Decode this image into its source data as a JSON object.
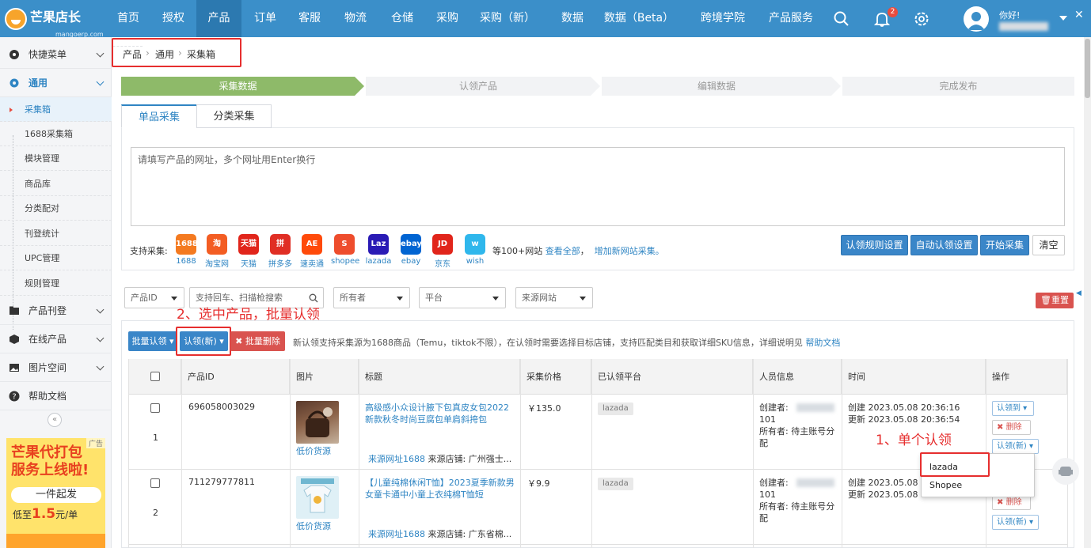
{
  "brand": {
    "name": "芒果店长",
    "domain": "mangoerp.com"
  },
  "topnav": [
    "首页",
    "授权",
    "产品",
    "订单",
    "客服",
    "物流",
    "仓储",
    "采购",
    "采购（新）",
    "数据",
    "数据（Beta）",
    "跨境学院",
    "产品服务"
  ],
  "notif_count": "2",
  "user": {
    "greeting": "你好!"
  },
  "sidebar": {
    "menus": [
      "快捷菜单",
      "通用",
      "产品刊登",
      "在线产品",
      "图片空间",
      "帮助文档"
    ],
    "subitems": [
      "采集箱",
      "1688采集箱",
      "模块管理",
      "商品库",
      "分类配对",
      "刊登统计",
      "UPC管理",
      "规则管理"
    ],
    "collapse": "«"
  },
  "ad": {
    "tag": "广告",
    "line1": "芒果代打包",
    "line2": "服务上线啦!",
    "line3": "一件起发",
    "line4_pre": "低至",
    "line4_num": "1.5",
    "line4_post": "元/单"
  },
  "breadcrumb": [
    "产品",
    "通用",
    "采集箱"
  ],
  "steps": [
    "采集数据",
    "认领产品",
    "编辑数据",
    "完成发布"
  ],
  "tabs": [
    "单品采集",
    "分类采集"
  ],
  "url_input": {
    "placeholder": "请填写产品的网址，多个网址用Enter换行"
  },
  "support": {
    "label": "支持采集:",
    "platforms": [
      {
        "name": "1688",
        "short": "1688",
        "color": "#f47a20"
      },
      {
        "name": "淘宝网",
        "short": "淘",
        "color": "#f35d23"
      },
      {
        "name": "天猫",
        "short": "天猫",
        "color": "#e1251b"
      },
      {
        "name": "拼多多",
        "short": "拼",
        "color": "#e02e24"
      },
      {
        "name": "速卖通",
        "short": "AE",
        "color": "#ff4a0a"
      },
      {
        "name": "shopee",
        "short": "S",
        "color": "#ee4d2d"
      },
      {
        "name": "lazada",
        "short": "Laz",
        "color": "#2a1bb5"
      },
      {
        "name": "ebay",
        "short": "ebay",
        "color": "#0064d2"
      },
      {
        "name": "京东",
        "short": "JD",
        "color": "#e1251b"
      },
      {
        "name": "wish",
        "short": "w",
        "color": "#2fb7ec"
      }
    ],
    "more_text": "等100+网站",
    "view_all": "查看全部",
    "add_site": "增加新网站采集。"
  },
  "actions": {
    "rule_setting": "认领规则设置",
    "auto_setting": "自动认领设置",
    "start": "开始采集",
    "clear": "清空"
  },
  "filters": {
    "product_id": "产品ID",
    "search_placeholder": "支持回车、扫描枪搜索",
    "owner": "所有者",
    "platform": "平台",
    "source": "来源网站",
    "reset": "重置"
  },
  "annotations": {
    "step2": "2、选中产品，批量认领",
    "step1": "1、单个认领"
  },
  "toolbar": {
    "batch_claim": "批量认领",
    "claim_new": "认领(新)",
    "batch_delete": "批量删除",
    "notice": "新认领支持采集源为1688商品（Temu，tiktok不限），在认领时需要选择目标店铺，支持匹配类目和获取详细SKU信息，详细说明见",
    "help_link": "帮助文档"
  },
  "table": {
    "headers": [
      "",
      "产品ID",
      "图片",
      "标题",
      "采集价格",
      "已认领平台",
      "人员信息",
      "时间",
      "操作"
    ],
    "rows": [
      {
        "index": "1",
        "id": "696058003029",
        "img_label": "低价货源",
        "title": "高级感小众设计腋下包真皮女包2022新款秋冬时尚豆腐包单肩斜挎包",
        "source_link": "来源网址1688",
        "shop": "来源店铺: 广州强士...",
        "price": "￥135.0",
        "claimed": "lazada",
        "creator": "创建者:",
        "creator_id": "101",
        "owner": "所有者: 待主账号分配",
        "created": "创建 2023.05.08 20:36:16",
        "updated": "更新 2023.05.08 20:36:54",
        "op_claim_to": "认领到",
        "op_delete": "删除",
        "op_claim_new": "认领(新)"
      },
      {
        "index": "2",
        "id": "711279777811",
        "img_label": "低价货源",
        "title": "【儿童纯棉休闲T恤】2023夏季新款男女童卡通中小童上衣纯棉T恤短",
        "source_link": "来源网址1688",
        "shop": "来源店铺: 广东省棉...",
        "price": "￥9.9",
        "claimed": "lazada",
        "creator": "创建者:",
        "creator_id": "101",
        "owner": "所有者: 待主账号分配",
        "created": "创建 2023.05.08 14",
        "updated": "更新 2023.05.08 14",
        "op_delete": "删除",
        "op_claim_new": "认领(新)"
      }
    ]
  },
  "dropdown": [
    "lazada",
    "Shopee"
  ]
}
